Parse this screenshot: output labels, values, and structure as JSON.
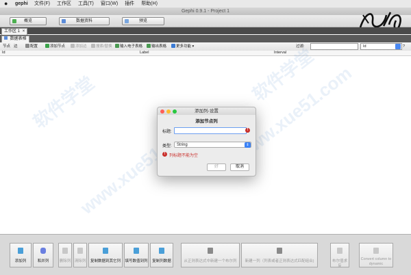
{
  "menubar": {
    "apple": "",
    "app": "gephi",
    "menus": [
      "文件(F)",
      "工作区",
      "工具(T)",
      "窗口(W)",
      "插件",
      "帮助(H)"
    ]
  },
  "window": {
    "title": "Gephi 0.9.1 - Project 1"
  },
  "workspace_bar": {
    "buttons": [
      "概览",
      "数据资料",
      "预览"
    ]
  },
  "tabs": {
    "workspace": "工作区 1",
    "data_table": "数据表格"
  },
  "toolbar": {
    "nodes": "节点",
    "edges": "边",
    "config": "配置",
    "add_node": "添加节点",
    "add_edge": "添加边",
    "search_replace": "搜索/替换",
    "import_spreadsheet": "输入电子表格",
    "export_table": "输出表格",
    "more": "更多功能",
    "filter_label": "过滤:",
    "filter_value": "",
    "column_select": "Id"
  },
  "table": {
    "columns": [
      "Id",
      "Label",
      "Interval"
    ]
  },
  "dialog": {
    "title": "添加列-设置",
    "heading": "添加节点列",
    "title_label": "标题:",
    "title_value": "",
    "type_label": "类型:",
    "type_value": "String",
    "error": "列标题不能为空",
    "ok": "好",
    "cancel": "取消",
    "error_icon": "!"
  },
  "bottom": {
    "buttons": [
      {
        "label": "添加列",
        "enabled": true
      },
      {
        "label": "和并列",
        "enabled": true
      },
      {
        "label": "删除列",
        "enabled": false
      },
      {
        "label": "清除列",
        "enabled": false
      },
      {
        "label": "复制数据到其它列",
        "enabled": true
      },
      {
        "label": "填写数值到列",
        "enabled": true
      },
      {
        "label": "复制列数据",
        "enabled": true
      },
      {
        "label": "从正则表达式中新建一个布尔列",
        "enabled": false
      },
      {
        "label": "新建一列（列表或者正则表达式匹配组合)",
        "enabled": false
      },
      {
        "label": "布尔值求反",
        "enabled": false
      },
      {
        "label": "Convert column to dynamic",
        "enabled": false
      }
    ]
  },
  "watermark": [
    "软件学堂",
    "www.xue51.com"
  ],
  "colors": {
    "accent": "#3b82f6",
    "error": "#c9302c",
    "menubar": "#e9e9e9",
    "tab_dark": "#4a4a4a"
  }
}
